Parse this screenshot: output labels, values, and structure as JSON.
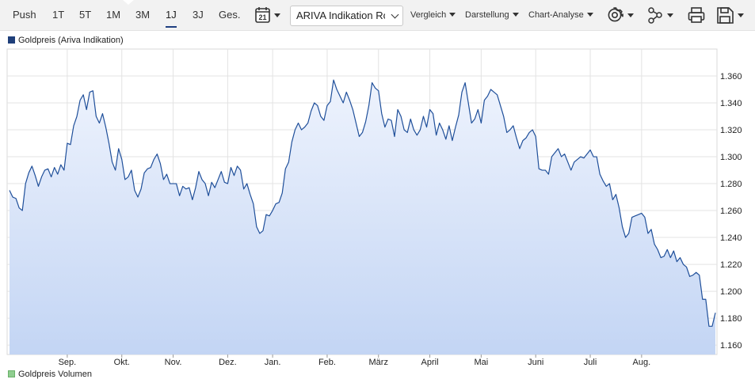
{
  "toolbar": {
    "push_label": "Push",
    "ranges": [
      "1T",
      "5T",
      "1M",
      "3M",
      "1J",
      "3J",
      "Ges."
    ],
    "selected_range": "1J",
    "calendar_day": "21",
    "source_select": "ARIVA Indikation Roh",
    "vergleich_label": "Vergleich",
    "darstellung_label": "Darstellung",
    "chartanalyse_label": "Chart-Analyse",
    "icons": [
      "calendar-icon",
      "gear-icon",
      "share-icon",
      "print-icon",
      "save-icon"
    ]
  },
  "legend": {
    "price_label": "Goldpreis (Ariva Indikation)",
    "price_color": "#1f3f7a",
    "volume_label": "Goldpreis Volumen",
    "volume_color": "#8fce8f"
  },
  "chart_data": {
    "type": "area",
    "series": [
      {
        "name": "Goldpreis (Ariva Indikation)",
        "values": [
          1275,
          1270,
          1269,
          1262,
          1260,
          1280,
          1288,
          1293,
          1286,
          1278,
          1285,
          1290,
          1291,
          1285,
          1292,
          1287,
          1294,
          1290,
          1310,
          1309,
          1323,
          1330,
          1342,
          1346,
          1335,
          1348,
          1349,
          1330,
          1325,
          1332,
          1322,
          1310,
          1296,
          1290,
          1306,
          1298,
          1283,
          1285,
          1290,
          1275,
          1270,
          1276,
          1288,
          1291,
          1292,
          1298,
          1302,
          1295,
          1283,
          1287,
          1280,
          1280,
          1280,
          1271,
          1278,
          1276,
          1277,
          1268,
          1277,
          1289,
          1283,
          1280,
          1271,
          1281,
          1277,
          1283,
          1289,
          1281,
          1280,
          1292,
          1286,
          1293,
          1290,
          1276,
          1280,
          1272,
          1265,
          1248,
          1243,
          1245,
          1257,
          1256,
          1260,
          1265,
          1266,
          1273,
          1291,
          1296,
          1311,
          1320,
          1325,
          1320,
          1322,
          1325,
          1334,
          1340,
          1338,
          1330,
          1327,
          1338,
          1341,
          1357,
          1350,
          1345,
          1340,
          1348,
          1342,
          1335,
          1325,
          1315,
          1318,
          1326,
          1338,
          1355,
          1351,
          1349,
          1332,
          1322,
          1328,
          1327,
          1315,
          1335,
          1330,
          1320,
          1318,
          1328,
          1320,
          1316,
          1320,
          1330,
          1322,
          1335,
          1332,
          1316,
          1325,
          1320,
          1313,
          1323,
          1312,
          1322,
          1331,
          1348,
          1355,
          1340,
          1325,
          1328,
          1335,
          1325,
          1342,
          1345,
          1350,
          1348,
          1346,
          1338,
          1330,
          1318,
          1320,
          1323,
          1314,
          1306,
          1312,
          1314,
          1318,
          1320,
          1315,
          1291,
          1290,
          1290,
          1287,
          1300,
          1303,
          1306,
          1300,
          1302,
          1296,
          1290,
          1296,
          1298,
          1300,
          1299,
          1302,
          1305,
          1300,
          1300,
          1287,
          1282,
          1278,
          1280,
          1268,
          1272,
          1262,
          1248,
          1240,
          1243,
          1255,
          1256,
          1257,
          1258,
          1255,
          1243,
          1246,
          1235,
          1231,
          1225,
          1226,
          1231,
          1225,
          1230,
          1222,
          1225,
          1220,
          1218,
          1211,
          1212,
          1214,
          1212,
          1194,
          1194,
          1174,
          1174,
          1184
        ]
      }
    ],
    "x_months": [
      "Sep.",
      "Okt.",
      "Nov.",
      "Dez.",
      "Jan.",
      "Feb.",
      "März",
      "April",
      "Mai",
      "Juni",
      "Juli",
      "Aug."
    ],
    "month_tick_index": [
      18,
      35,
      51,
      68,
      82,
      99,
      115,
      131,
      147,
      164,
      181,
      197
    ],
    "y_ticks": [
      1160,
      1180,
      1200,
      1220,
      1240,
      1260,
      1280,
      1300,
      1320,
      1340,
      1360
    ],
    "y_tick_labels": [
      "1.160",
      "1.180",
      "1.200",
      "1.220",
      "1.240",
      "1.260",
      "1.280",
      "1.300",
      "1.320",
      "1.340",
      "1.360"
    ],
    "ylim": [
      1153,
      1380
    ],
    "grid": true,
    "legend_position": "top-left",
    "line_color": "#1f4f9a"
  }
}
